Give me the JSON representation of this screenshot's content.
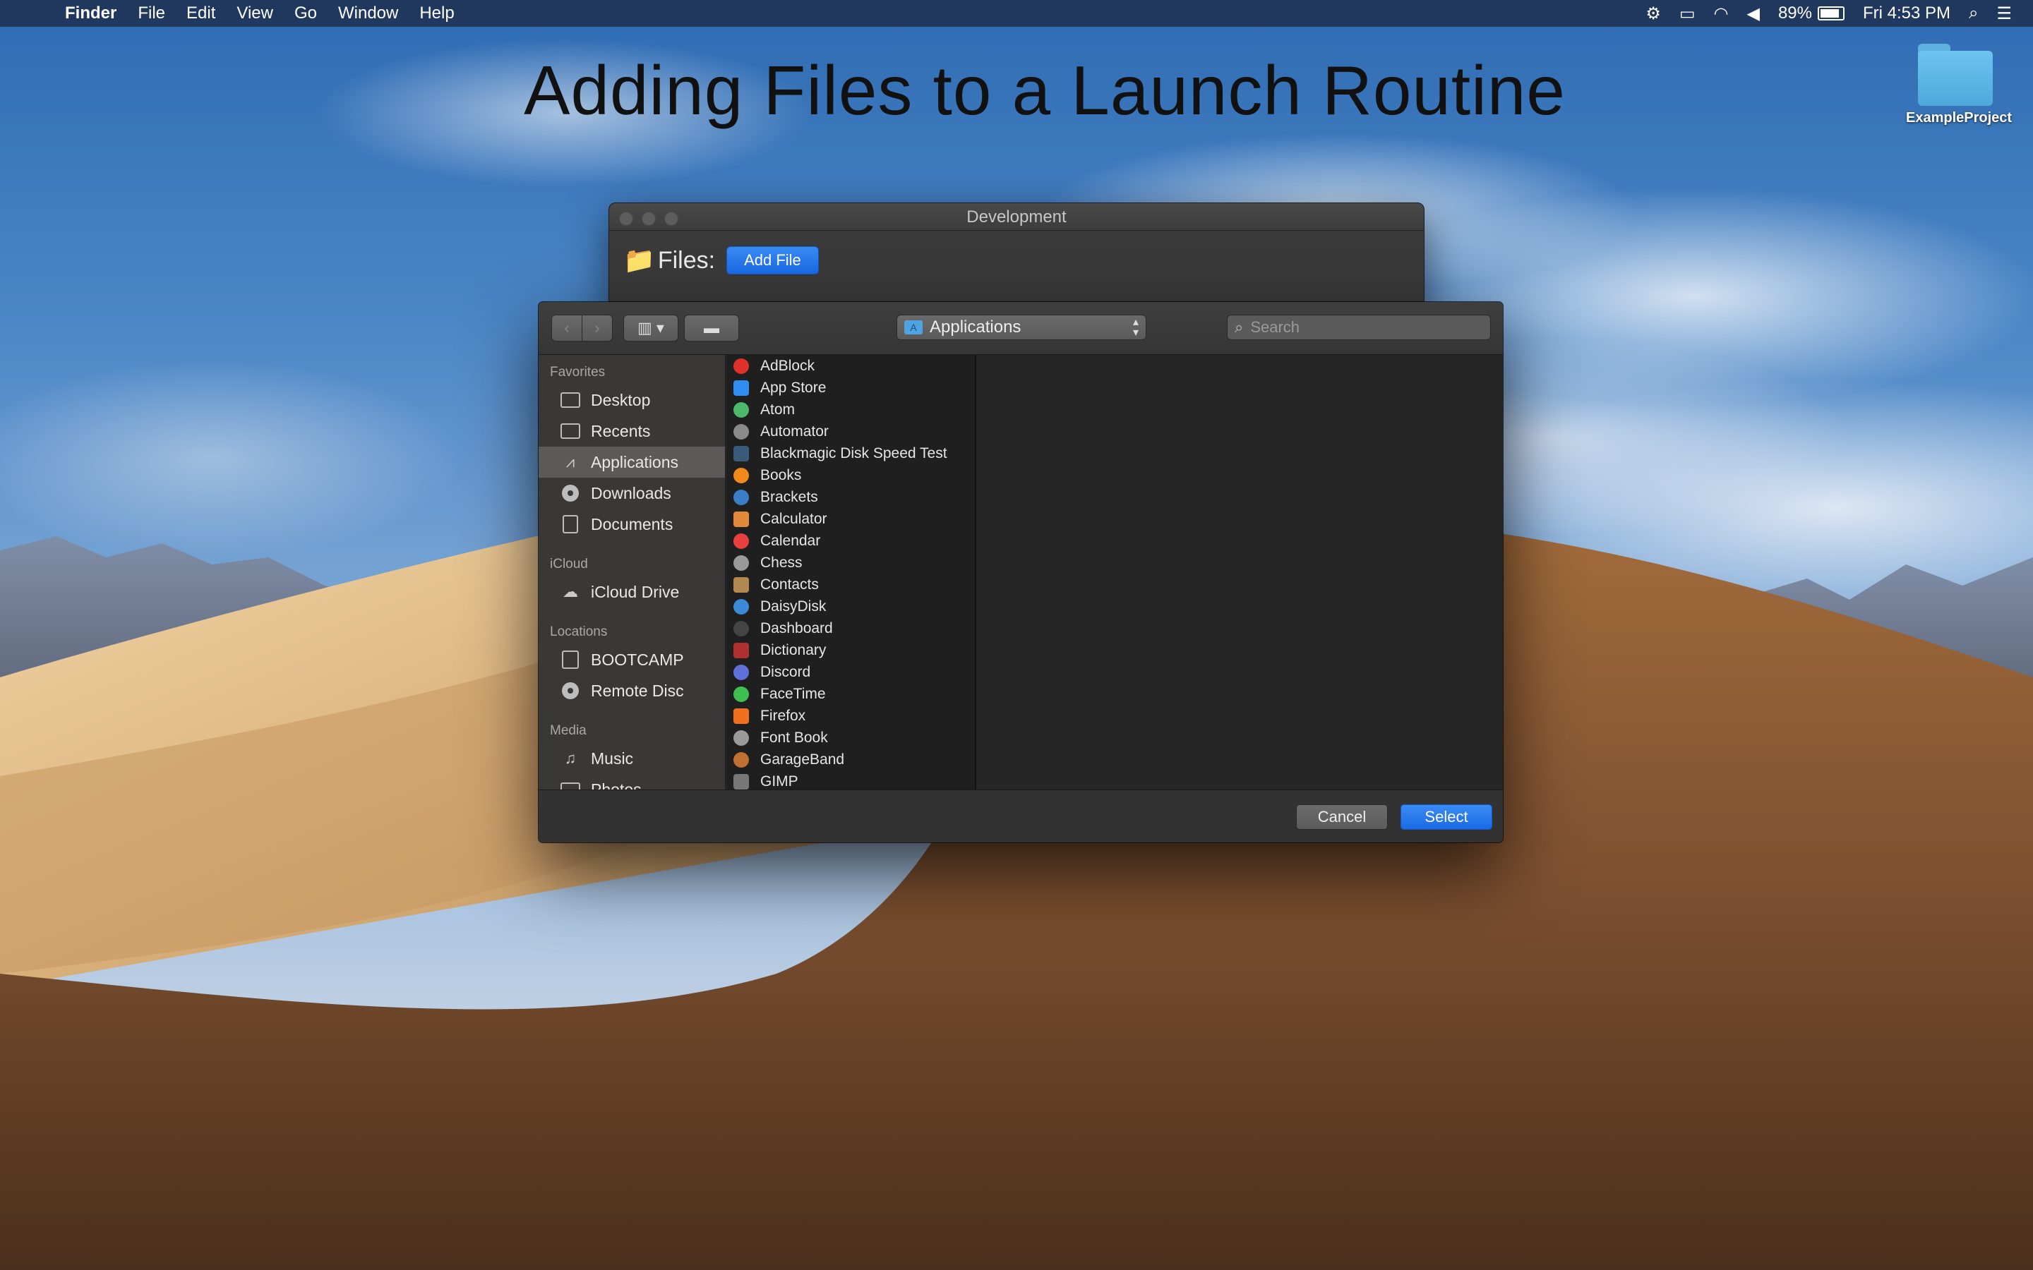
{
  "menubar": {
    "apple_icon": "apple-icon",
    "app_name": "Finder",
    "items": [
      "File",
      "Edit",
      "View",
      "Go",
      "Window",
      "Help"
    ],
    "battery": "89%",
    "clock": "Fri 4:53 PM"
  },
  "headline": "Adding Files to a Launch Routine",
  "desktop": {
    "folder_label": "ExampleProject"
  },
  "dev_window": {
    "title": "Development",
    "files_label": "Files:",
    "add_button": "Add File"
  },
  "dialog": {
    "location": "Applications",
    "search_placeholder": "Search",
    "sidebar": {
      "sections": [
        {
          "title": "Favorites",
          "items": [
            {
              "label": "Desktop",
              "icon": "desktop-icon"
            },
            {
              "label": "Recents",
              "icon": "recents-icon"
            },
            {
              "label": "Applications",
              "icon": "applications-icon",
              "selected": true
            },
            {
              "label": "Downloads",
              "icon": "downloads-icon"
            },
            {
              "label": "Documents",
              "icon": "documents-icon"
            }
          ]
        },
        {
          "title": "iCloud",
          "items": [
            {
              "label": "iCloud Drive",
              "icon": "cloud-icon"
            }
          ]
        },
        {
          "title": "Locations",
          "items": [
            {
              "label": "BOOTCAMP",
              "icon": "drive-icon"
            },
            {
              "label": "Remote Disc",
              "icon": "disc-icon"
            }
          ]
        },
        {
          "title": "Media",
          "items": [
            {
              "label": "Music",
              "icon": "music-icon"
            },
            {
              "label": "Photos",
              "icon": "camera-icon"
            }
          ]
        }
      ]
    },
    "files": [
      {
        "name": "AdBlock",
        "color": "#e0302a"
      },
      {
        "name": "App Store",
        "color": "#2f8cf0"
      },
      {
        "name": "Atom",
        "color": "#4bb86a"
      },
      {
        "name": "Automator",
        "color": "#8a8a8a"
      },
      {
        "name": "Blackmagic Disk Speed Test",
        "color": "#3a5a7a"
      },
      {
        "name": "Books",
        "color": "#f08a1c"
      },
      {
        "name": "Brackets",
        "color": "#3a7ec8"
      },
      {
        "name": "Calculator",
        "color": "#e08a3a"
      },
      {
        "name": "Calendar",
        "color": "#e84040"
      },
      {
        "name": "Chess",
        "color": "#9a9a9a"
      },
      {
        "name": "Contacts",
        "color": "#b08850"
      },
      {
        "name": "DaisyDisk",
        "color": "#3a8ad8"
      },
      {
        "name": "Dashboard",
        "color": "#444444"
      },
      {
        "name": "Dictionary",
        "color": "#b03030"
      },
      {
        "name": "Discord",
        "color": "#6070d8"
      },
      {
        "name": "FaceTime",
        "color": "#3ec050"
      },
      {
        "name": "Firefox",
        "color": "#f07020"
      },
      {
        "name": "Font Book",
        "color": "#9a9a9a"
      },
      {
        "name": "GarageBand",
        "color": "#c07030"
      },
      {
        "name": "GIMP",
        "color": "#777777"
      }
    ],
    "cancel_label": "Cancel",
    "select_label": "Select"
  }
}
